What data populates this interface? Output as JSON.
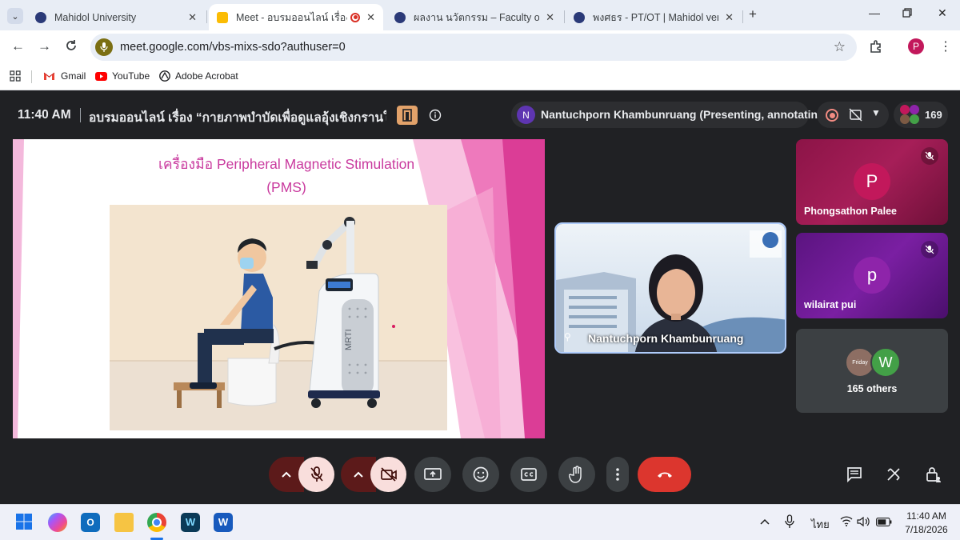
{
  "browser": {
    "tabs": [
      {
        "title": "Mahidol University",
        "close": "✕"
      },
      {
        "title": "Meet - อบรมออนไลน์ เรื่อง “กา",
        "close": "✕"
      },
      {
        "title": "ผลงาน นวัตกรรม – Faculty of Phy",
        "close": "✕"
      },
      {
        "title": "พงศธร - PT/OT | Mahidol version",
        "close": "✕"
      }
    ],
    "new_tab": "+",
    "url": "meet.google.com/vbs-mixs-sdo?authuser=0",
    "profile_initial": "P",
    "bookmarks": [
      {
        "label": "Gmail",
        "icon": "gmail-icon"
      },
      {
        "label": "YouTube",
        "icon": "youtube-icon"
      },
      {
        "label": "Adobe Acrobat",
        "icon": "acrobat-icon"
      }
    ]
  },
  "meet": {
    "time": "11:40 AM",
    "title": "อบรมออนไลน์ เรื่อง “กายภาพบำบัดเพื่อดูแลอุ้งเชิงกรานในเพ...",
    "presenter_initial": "N",
    "presenter_status": "Nantuchporn Khambunruang (Presenting, annotating)",
    "participant_count": "169",
    "slide": {
      "title_line1": "เครื่องมือ Peripheral Magnetic Stimulation",
      "title_line2": "(PMS)",
      "device_label": "MRTI"
    },
    "speaker": {
      "name": "Nantuchporn Khambunruang"
    },
    "participants": [
      {
        "initial": "P",
        "name": "Phongsathon Palee",
        "color": "#c2185b"
      },
      {
        "initial": "p",
        "name": "wilairat pui",
        "color": "#8e24aa"
      }
    ],
    "others": {
      "label": "165 others",
      "avatar2_initial": "W",
      "avatar1_text": "Friday"
    }
  },
  "taskbar": {
    "time": "11:40 AM",
    "date": "7/18/2026",
    "lang": "ไทย"
  }
}
